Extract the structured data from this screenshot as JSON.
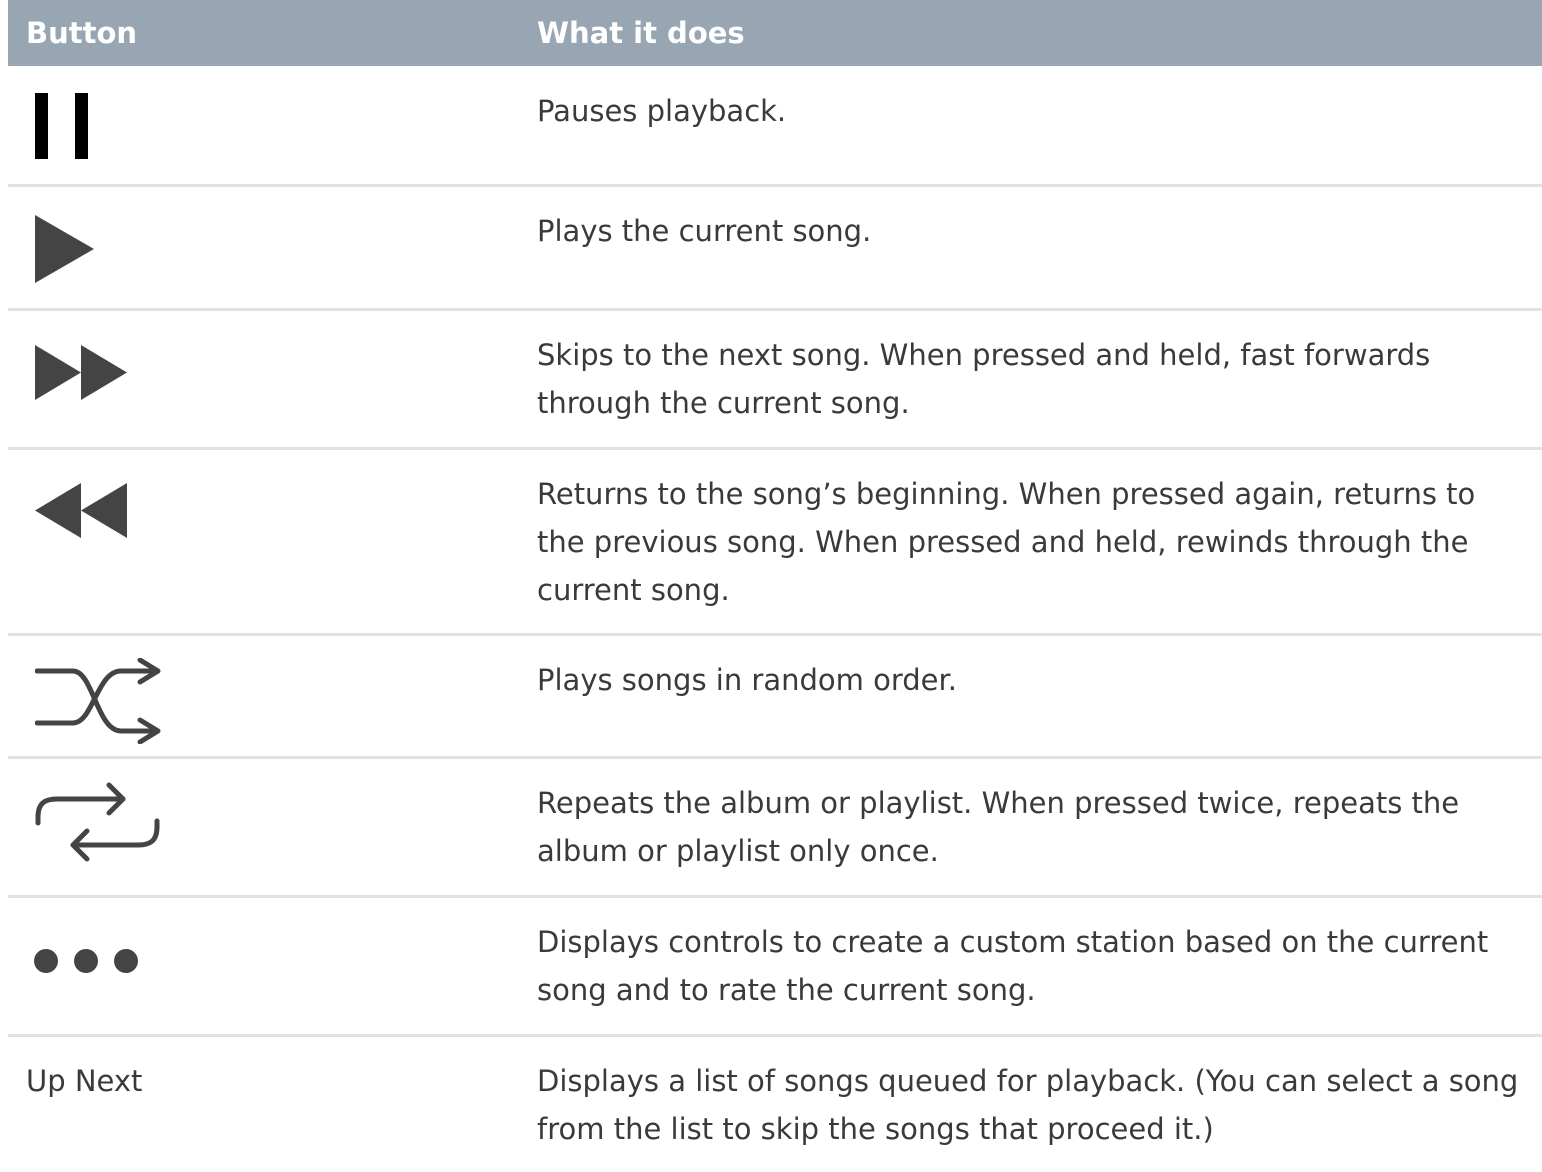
{
  "header": {
    "button_col": "Button",
    "desc_col": "What it does"
  },
  "rows": [
    {
      "icon": "pause-icon",
      "description": "Pauses playback."
    },
    {
      "icon": "play-icon",
      "description": "Plays the current song."
    },
    {
      "icon": "fast-forward-icon",
      "description": "Skips to the next song. When pressed and held, fast forwards through the current song."
    },
    {
      "icon": "rewind-icon",
      "description": "Returns to the song’s beginning. When pressed again, returns to the previous song. When pressed and held, rewinds through the current song."
    },
    {
      "icon": "shuffle-icon",
      "description": "Plays songs in random order."
    },
    {
      "icon": "repeat-icon",
      "description": "Repeats the album or playlist. When pressed twice, repeats the album or playlist only once."
    },
    {
      "icon": "more-icon",
      "description": "Displays controls to create a custom station based on the current song and to rate the current song."
    },
    {
      "label": "Up Next",
      "description": "Displays a list of songs queued for playback. (You can select a song from the list to skip the songs that proceed it.)"
    }
  ],
  "colors": {
    "header_bg": "#98a6b3",
    "divider": "#e2e2e2",
    "icon": "#444444"
  }
}
